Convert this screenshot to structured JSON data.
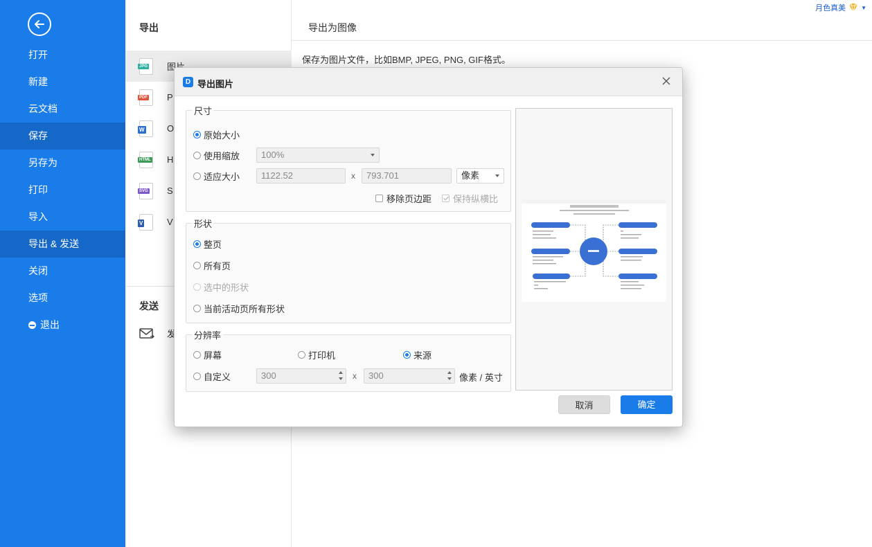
{
  "sidebar": {
    "items": [
      {
        "label": "打开"
      },
      {
        "label": "新建"
      },
      {
        "label": "云文档"
      },
      {
        "label": "保存"
      },
      {
        "label": "另存为"
      },
      {
        "label": "打印"
      },
      {
        "label": "导入"
      },
      {
        "label": "导出 & 发送"
      },
      {
        "label": "关闭"
      },
      {
        "label": "选项"
      },
      {
        "label": "退出"
      }
    ]
  },
  "export": {
    "title": "导出",
    "formats": [
      {
        "badge": "JPG",
        "label": "图片"
      },
      {
        "badge": "PDF",
        "label": "P"
      },
      {
        "badge": "W",
        "label": "O"
      },
      {
        "badge": "HTML",
        "label": "H"
      },
      {
        "badge": "SVG",
        "label": "S"
      },
      {
        "badge": "V",
        "label": "V"
      }
    ],
    "send_title": "发送",
    "send_item": "发"
  },
  "right": {
    "title": "导出为图像",
    "desc": "保存为图片文件，比如BMP, JPEG, PNG, GIF格式。"
  },
  "user": {
    "name": "月色真美"
  },
  "dialog": {
    "logo": "D",
    "title": "导出图片",
    "size": {
      "legend": "尺寸",
      "original": "原始大小",
      "scale": "使用缩放",
      "scale_value": "100%",
      "fit": "适应大小",
      "width": "1122.52",
      "x": "x",
      "height": "793.701",
      "unit": "像素",
      "remove_margin": "移除页边距",
      "keep_ratio": "保持纵横比"
    },
    "shape": {
      "legend": "形状",
      "whole_page": "整页",
      "all_pages": "所有页",
      "selected": "选中的形状",
      "current_page_all": "当前活动页所有形状"
    },
    "resolution": {
      "legend": "分辨率",
      "screen": "屏幕",
      "printer": "打印机",
      "source": "来源",
      "custom": "自定义",
      "dpi_x": "300",
      "x": "x",
      "dpi_y": "300",
      "unit": "像素 / 英寸"
    },
    "cancel": "取消",
    "ok": "确定"
  },
  "colors": {
    "accent": "#1a7ce8"
  }
}
